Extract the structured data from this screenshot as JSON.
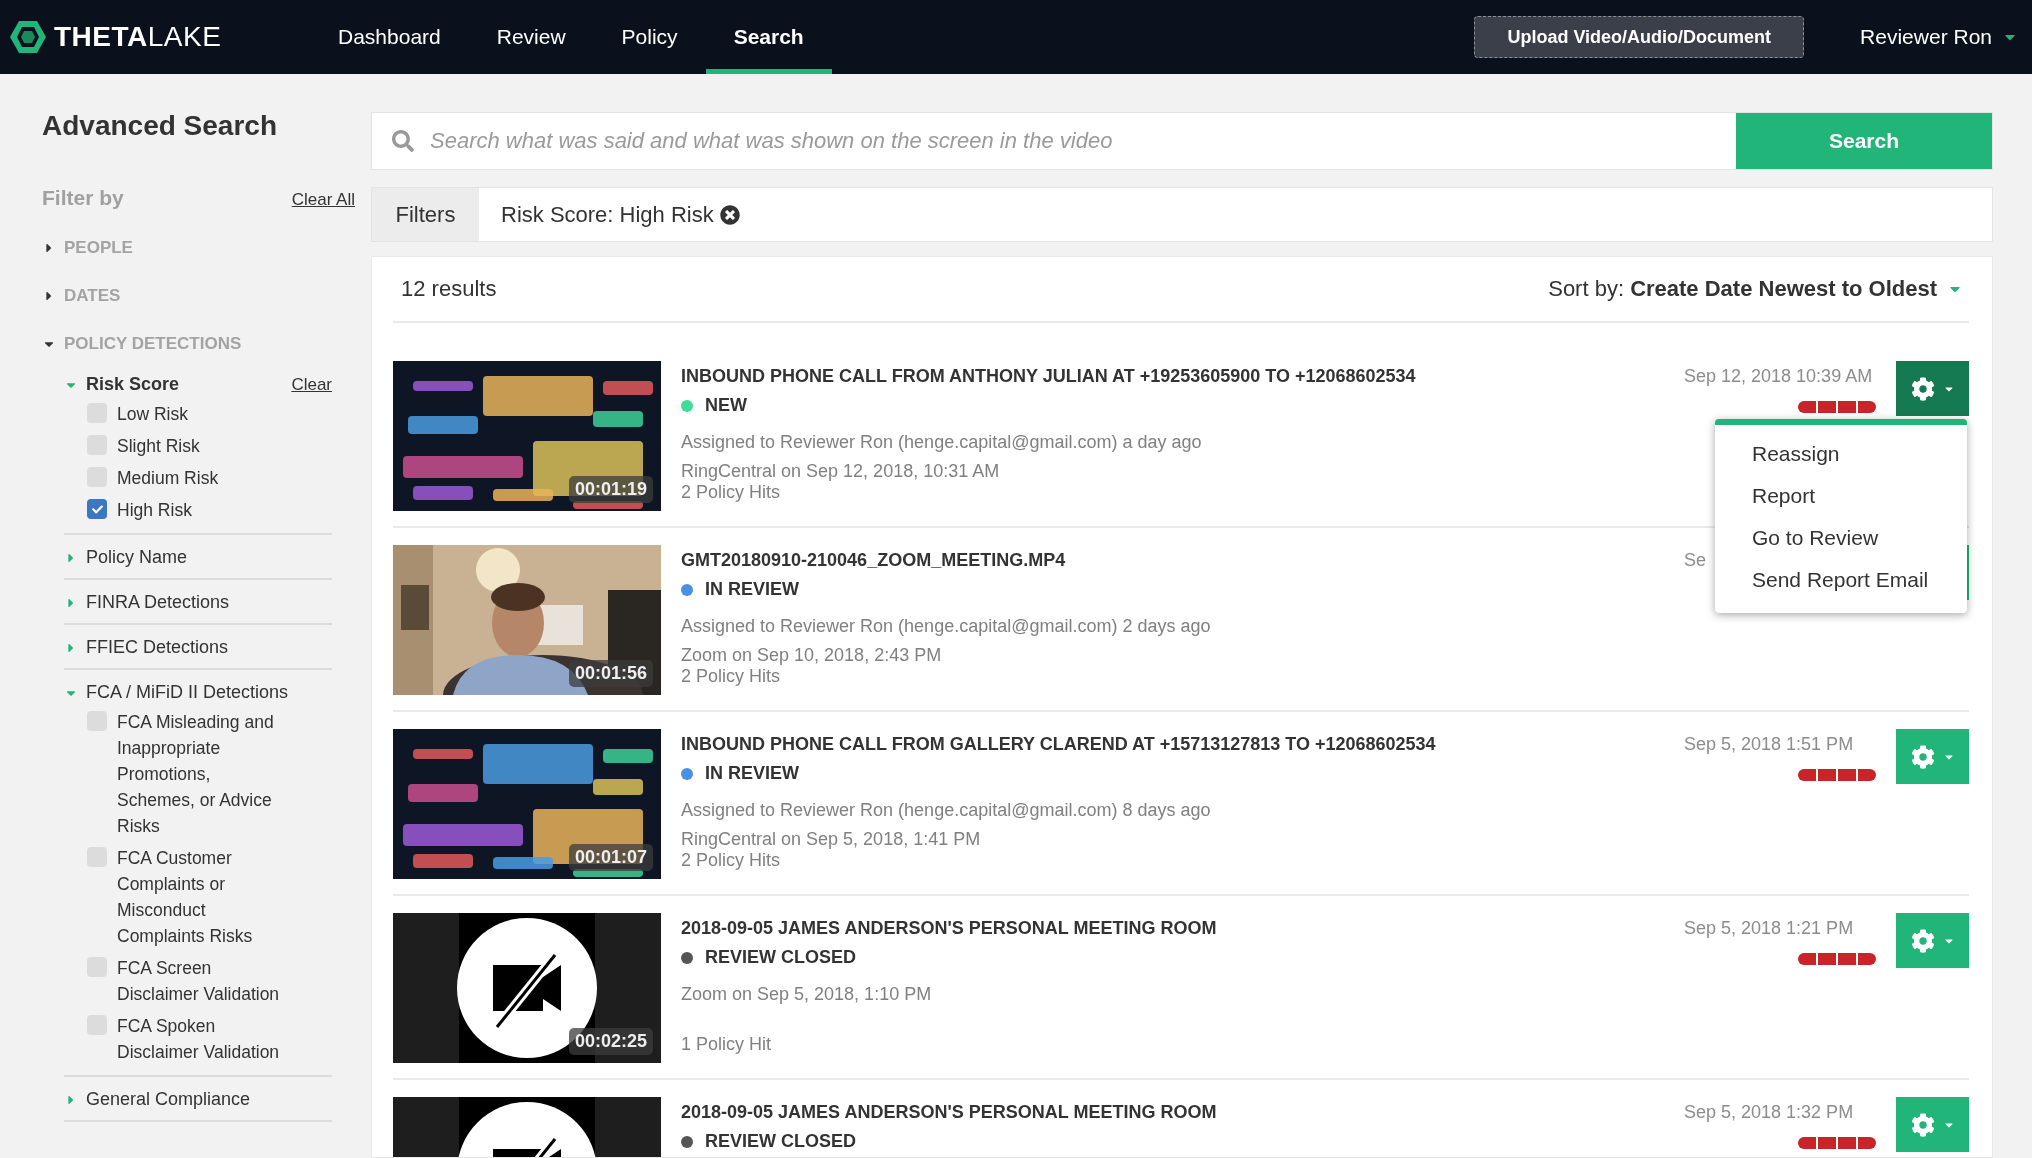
{
  "header": {
    "logo": "**THETA**LAKE",
    "nav": [
      {
        "label": "Dashboard",
        "selected": false
      },
      {
        "label": "Review",
        "selected": false
      },
      {
        "label": "Policy",
        "selected": false
      },
      {
        "label": "Search",
        "selected": true
      }
    ],
    "upload_button": "Upload Video/Audio/Document",
    "user": "Reviewer Ron"
  },
  "sidebar": {
    "title": "Advanced Search",
    "filter_label": "Filter by",
    "clear_all": "Clear All",
    "sections": [
      {
        "label": "PEOPLE",
        "expanded": false
      },
      {
        "label": "DATES",
        "expanded": false
      },
      {
        "label": "POLICY DETECTIONS",
        "expanded": true,
        "children": [
          {
            "label": "Risk Score",
            "expanded": true,
            "clear": "Clear",
            "options": [
              {
                "label": "Low Risk",
                "checked": false
              },
              {
                "label": "Slight Risk",
                "checked": false
              },
              {
                "label": "Medium Risk",
                "checked": false
              },
              {
                "label": "High Risk",
                "checked": true
              }
            ]
          },
          {
            "label": "Policy Name",
            "expanded": false
          },
          {
            "label": "FINRA Detections",
            "expanded": false
          },
          {
            "label": "FFIEC Detections",
            "expanded": false
          },
          {
            "label": "FCA / MiFiD II Detections",
            "expanded": true,
            "options": [
              {
                "label": "FCA Misleading and Inappropriate Promotions, Schemes, or Advice Risks",
                "checked": false
              },
              {
                "label": "FCA Customer Complaints or Misconduct Complaints Risks",
                "checked": false
              },
              {
                "label": "FCA Screen Disclaimer Validation",
                "checked": false
              },
              {
                "label": "FCA Spoken Disclaimer Validation",
                "checked": false
              }
            ]
          },
          {
            "label": "General Compliance",
            "expanded": false
          }
        ]
      }
    ]
  },
  "search": {
    "placeholder": "Search what was said and what was shown on the screen in the video",
    "button": "Search"
  },
  "filters": {
    "label": "Filters",
    "chips": [
      "Risk Score: High Risk"
    ]
  },
  "results": {
    "count": "12 results",
    "sort": "Sort by: **Create Date Newest to Oldest**",
    "rows": [
      {
        "kind": "wordcloud",
        "duration": "00:01:19",
        "title": "INBOUND PHONE CALL FROM ANTHONY JULIAN AT +19253605900 TO +12068602534",
        "status": "NEW",
        "color": "#3ddc97",
        "meta": [
          "Assigned to Reviewer Ron (henge.capital@gmail.com) a day ago",
          "RingCentral on Sep 12, 2018, 10:31 AM"
        ],
        "hits": "2 Policy Hits",
        "date": "Sep 12, 2018 10:39 AM",
        "menu_open": true
      },
      {
        "duration": "00:01:56",
        "title": "GMT20180910-210046_ZOOM_MEETING.MP4",
        "status": "IN REVIEW",
        "color": "#4a90e2",
        "meta": [
          "Assigned to Reviewer Ron (henge.capital@gmail.com) 2 days ago",
          "Zoom on Sep 10, 2018, 2:43 PM"
        ],
        "hits": "2 Policy Hits",
        "date": "Se",
        "menu_open": false
      },
      {
        "kind": "wordcloud",
        "duration": "00:01:07",
        "title": "INBOUND PHONE CALL FROM GALLERY CLAREND AT +15713127813 TO +12068602534",
        "status": "IN REVIEW",
        "color": "#4a90e2",
        "meta": [
          "Assigned to Reviewer Ron (henge.capital@gmail.com) 8 days ago",
          "RingCentral on Sep 5, 2018, 1:41 PM"
        ],
        "hits": "2 Policy Hits",
        "date": "Sep 5, 2018 1:51 PM",
        "menu_open": false
      },
      {
        "kind": "no-video",
        "duration": "00:02:25",
        "title": "2018-09-05 JAMES ANDERSON'S PERSONAL MEETING ROOM",
        "status": "REVIEW CLOSED",
        "color": "#555555",
        "meta": [
          "Zoom on Sep 5, 2018, 1:10 PM"
        ],
        "hits": "1 Policy Hit",
        "date": "Sep 5, 2018 1:21 PM",
        "menu_open": false
      },
      {
        "kind": "no-video",
        "title": "2018-09-05 JAMES ANDERSON'S PERSONAL MEETING ROOM",
        "status": "REVIEW CLOSED",
        "color": "#555555",
        "date": "Sep 5, 2018 1:32 PM",
        "menu_open": false
      }
    ],
    "menu": [
      "Reassign",
      "Report",
      "Go to Review",
      "Send Report Email"
    ]
  }
}
